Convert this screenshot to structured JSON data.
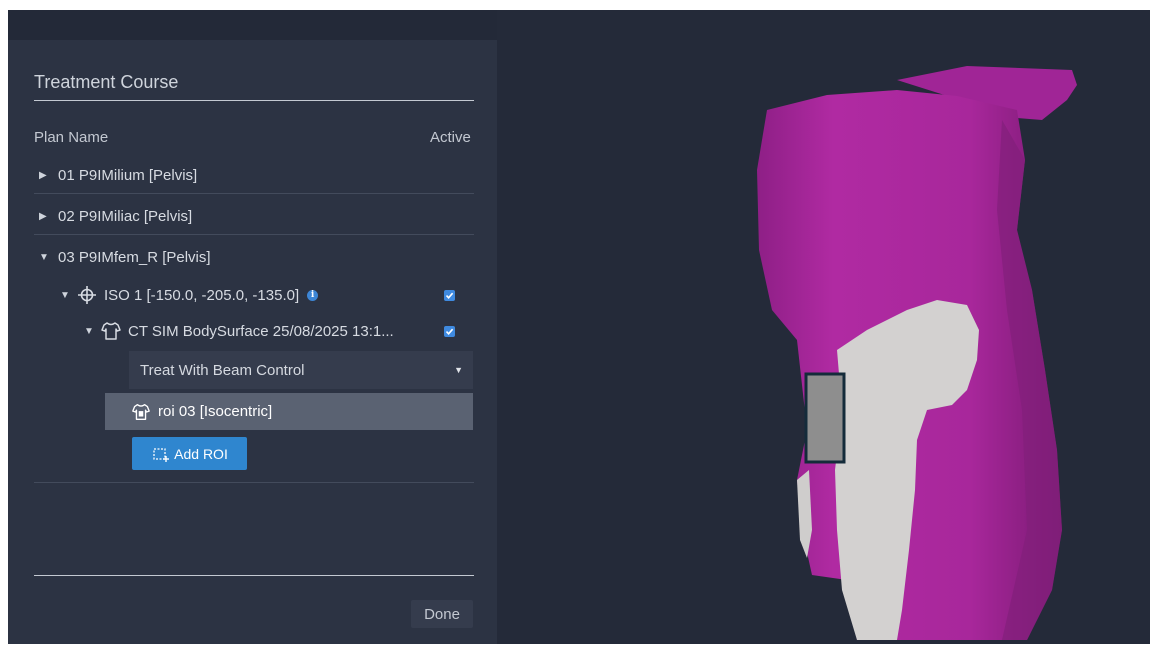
{
  "panel": {
    "title": "Treatment Course",
    "columns": {
      "plan_name": "Plan Name",
      "active": "Active"
    },
    "plans": [
      {
        "label": "01 P9IMilium [Pelvis]",
        "expanded": false
      },
      {
        "label": "02 P9IMiliac [Pelvis]",
        "expanded": false
      },
      {
        "label": "03 P9IMfem_R [Pelvis]",
        "expanded": true
      }
    ],
    "iso": {
      "label": "ISO 1 [-150.0, -205.0, -135.0]",
      "active": true,
      "icon": "crosshair-icon",
      "info_icon": "info-icon"
    },
    "surface": {
      "label": "CT SIM BodySurface 25/08/2025 13:1...",
      "active": true,
      "icon": "body-outline-icon"
    },
    "dropdown": {
      "value": "Treat With Beam Control"
    },
    "roi": {
      "label": "roi 03 [Isocentric]",
      "icon": "roi-body-icon"
    },
    "add_roi": {
      "label": "Add ROI",
      "icon": "add-roi-icon"
    },
    "done": "Done"
  },
  "colors": {
    "accent": "#2f86cf",
    "panel_bg": "#2c3343",
    "viewport_bg": "#242a39",
    "surface_magenta": "#a8269a",
    "roi_gray": "#d3d1d0"
  }
}
